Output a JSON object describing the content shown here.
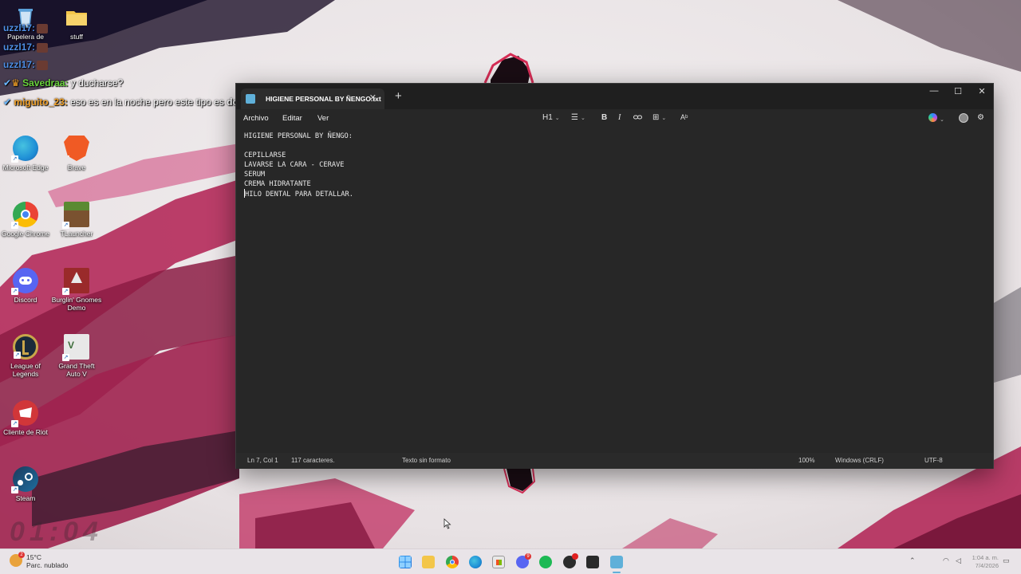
{
  "desktop": {
    "icons": [
      {
        "label": "Papelera de",
        "icon": "recycle-bin-icon",
        "color": "#5aa0d8"
      },
      {
        "label": "stuff",
        "icon": "folder-icon",
        "color": "#f3c64a"
      },
      {
        "label": "Microsoft Edge",
        "icon": "edge-icon",
        "color": "#1f8fd6"
      },
      {
        "label": "Brave",
        "icon": "brave-icon",
        "color": "#f05a24"
      },
      {
        "label": "Google Chrome",
        "icon": "chrome-icon",
        "color": "#34a853"
      },
      {
        "label": "TLauncher",
        "icon": "minecraft-icon",
        "color": "#5b8a32"
      },
      {
        "label": "Discord",
        "icon": "discord-icon",
        "color": "#5865f2"
      },
      {
        "label": "Burglin' Gnomes Demo",
        "icon": "gnome-game-icon",
        "color": "#9a2a2a"
      },
      {
        "label": "League of Legends",
        "icon": "league-icon",
        "color": "#c8a64a"
      },
      {
        "label": "Grand Theft Auto V",
        "icon": "gta-icon",
        "color": "#3d6d3a"
      },
      {
        "label": "Cliente de Riot",
        "icon": "riot-icon",
        "color": "#d13639"
      },
      {
        "label": "Steam",
        "icon": "steam-icon",
        "color": "#1b3a5c"
      }
    ]
  },
  "chat": {
    "lines": [
      {
        "user": "uzzl17:",
        "text": ""
      },
      {
        "user": "uzzl17:",
        "text": ""
      },
      {
        "user": "uzzl17:",
        "text": ""
      },
      {
        "user": "Savedraa:",
        "text": "y ducharse?"
      },
      {
        "user": "miguito_23:",
        "text": "eso es en la noche pero este tipo es",
        "highlight": "down"
      }
    ]
  },
  "overlay_clock": "01:04",
  "notepad": {
    "tab_title": "HIGIENE PERSONAL BY ÑENGO.txt",
    "new_tab_label": "+",
    "tab_close_label": "✕",
    "window_controls": {
      "minimize": "—",
      "maximize": "☐",
      "close": "✕"
    },
    "menu": [
      "Archivo",
      "Editar",
      "Ver"
    ],
    "toolbar": {
      "heading": "H1",
      "list": "☰",
      "bold": "B",
      "italic": "I",
      "link": "🔗",
      "table": "⊞",
      "spell": "Aᵇ"
    },
    "content": [
      "HIGIENE PERSONAL BY ÑENGO:",
      "",
      "CEPILLARSE",
      "LAVARSE LA CARA - CERAVE",
      "SERUM",
      "CREMA HIDRATANTE",
      "HILO DENTAL PARA DETALLAR."
    ],
    "status": {
      "position": "Ln 7, Col 1",
      "chars": "117 caracteres.",
      "format": "Texto sin formato",
      "zoom": "100%",
      "line_endings": "Windows (CRLF)",
      "encoding": "UTF-8"
    }
  },
  "taskbar": {
    "weather": {
      "temp": "15°C",
      "desc": "Parc. nublado",
      "badge": "2"
    },
    "discord_badge": "9",
    "clock_time": "1:04 a. m.",
    "clock_date": "7/4/2026"
  }
}
